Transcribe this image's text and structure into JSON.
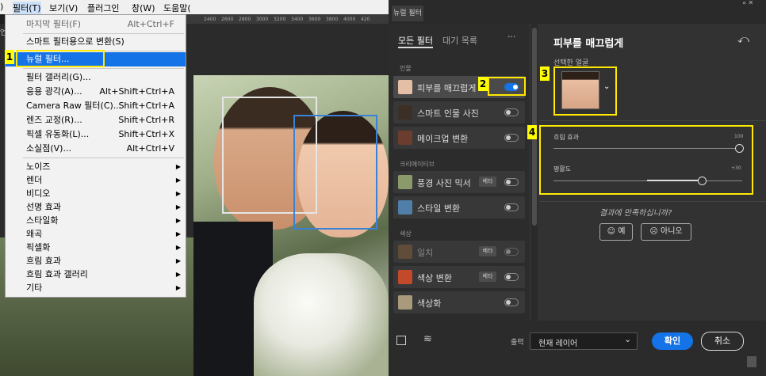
{
  "menubar": {
    "items": [
      {
        "label": ") "
      },
      {
        "label": "필터(T)"
      },
      {
        "label": "보기(V)"
      },
      {
        "label": "플러그인"
      },
      {
        "label": "창(W)"
      },
      {
        "label": "도움말("
      }
    ]
  },
  "ruler": {
    "ticks": [
      "2400",
      "2600",
      "2800",
      "3000",
      "3200",
      "3400",
      "3600",
      "3800",
      "4000",
      "420"
    ]
  },
  "filter_menu": {
    "items": [
      {
        "label": "마지막 필터(F)",
        "shortcut": "Alt+Ctrl+F"
      },
      {
        "label": "스마트 필터용으로 변환(S)",
        "shortcut": ""
      },
      {
        "label": "뉴럴 필터...",
        "shortcut": ""
      },
      {
        "label": "필터 갤러리(G)...",
        "shortcut": ""
      },
      {
        "label": "응용 광각(A)...",
        "shortcut": "Alt+Shift+Ctrl+A"
      },
      {
        "label": "Camera Raw 필터(C)...",
        "shortcut": "Shift+Ctrl+A"
      },
      {
        "label": "렌즈 교정(R)...",
        "shortcut": "Shift+Ctrl+R"
      },
      {
        "label": "픽셀 유동화(L)...",
        "shortcut": "Shift+Ctrl+X"
      },
      {
        "label": "소실점(V)...",
        "shortcut": "Alt+Ctrl+V"
      },
      {
        "label": "노이즈",
        "shortcut": ""
      },
      {
        "label": "렌더",
        "shortcut": ""
      },
      {
        "label": "비디오",
        "shortcut": ""
      },
      {
        "label": "선명 효과",
        "shortcut": ""
      },
      {
        "label": "스타일화",
        "shortcut": ""
      },
      {
        "label": "왜곡",
        "shortcut": ""
      },
      {
        "label": "픽셀화",
        "shortcut": ""
      },
      {
        "label": "흐림 효과",
        "shortcut": ""
      },
      {
        "label": "흐림 효과 갤러리",
        "shortcut": ""
      },
      {
        "label": "기타",
        "shortcut": ""
      }
    ],
    "submenu_arrow": "▶"
  },
  "left_edge_text": "언",
  "markers": [
    "1",
    "2",
    "3",
    "4"
  ],
  "neural_filters": {
    "window_title": "뉴럴 필터",
    "window_controls": "« ✕",
    "tabs": {
      "all": "모든 필터",
      "waitlist": "대기 목록",
      "more": "···"
    },
    "categories": {
      "portrait": "인물",
      "creative": "크리에이티브",
      "color": "색상"
    },
    "filters": [
      {
        "name": "피부를 매끄럽게",
        "beta": "",
        "toggle": "on"
      },
      {
        "name": "스마트 인물 사진",
        "beta": "",
        "toggle": "off"
      },
      {
        "name": "메이크업 변환",
        "beta": "",
        "toggle": "off"
      },
      {
        "name": "풍경 사진 믹서",
        "beta": "베타",
        "toggle": "off"
      },
      {
        "name": "스타일 변환",
        "beta": "",
        "toggle": "off"
      },
      {
        "name": "일치",
        "beta": "베타",
        "toggle": "disabled"
      },
      {
        "name": "색상 변환",
        "beta": "베타",
        "toggle": "off"
      },
      {
        "name": "색상화",
        "beta": "",
        "toggle": "off"
      }
    ],
    "detail": {
      "title": "피부를 매끄럽게",
      "selected_face_label": "선택한 얼굴",
      "sliders": [
        {
          "label": "흐림 효과",
          "value_text": "100",
          "value": 100,
          "max": 100
        },
        {
          "label": "평활도",
          "value_text": "+30",
          "value": 30,
          "min": -50,
          "max": 50
        }
      ],
      "feedback_question": "결과에 만족하십니까?",
      "yes_label": "예",
      "no_label": "아니오"
    },
    "bottom": {
      "output_label": "출력",
      "output_value": "현재 레이어",
      "ok_label": "확인",
      "cancel_label": "취소"
    }
  },
  "colors": {
    "accent": "#1473e6",
    "highlight_box": "#ffea00",
    "face_box_selected": "#3a82d6"
  }
}
